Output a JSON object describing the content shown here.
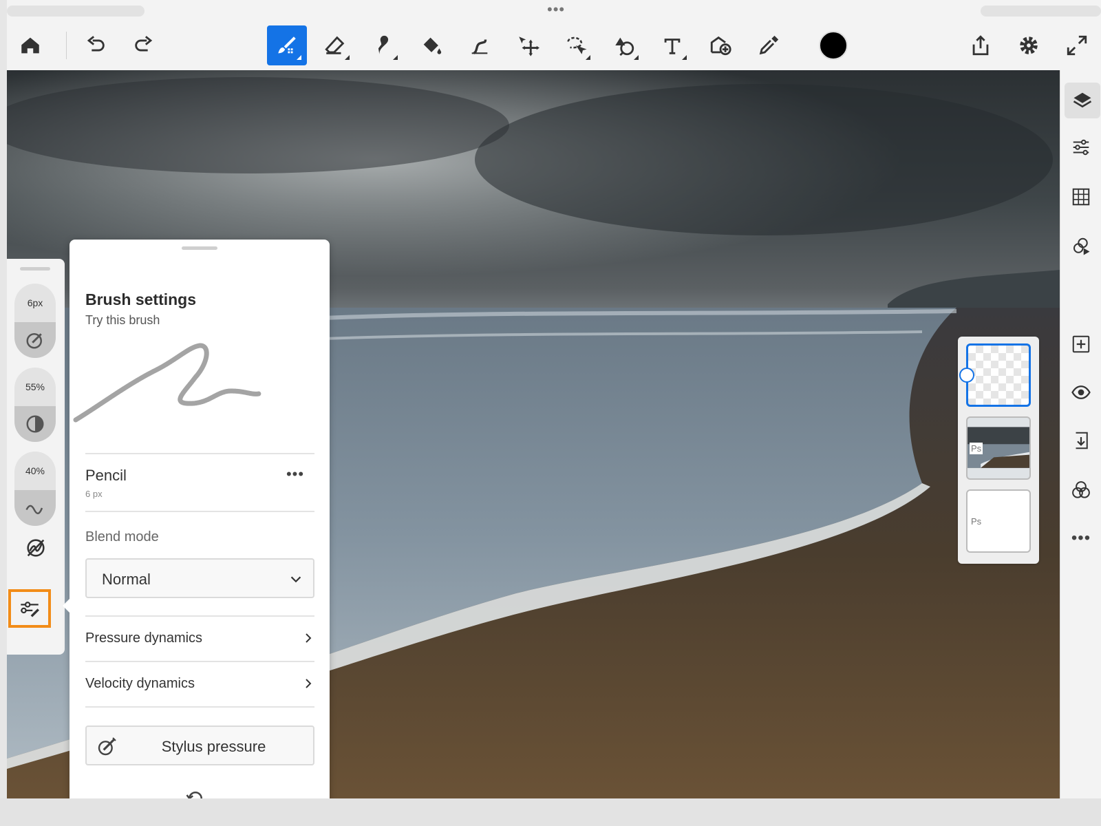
{
  "toolbar": {
    "tools": [
      "home-icon",
      "undo-icon",
      "redo-icon",
      "brush-icon",
      "eraser-icon",
      "smudge-icon",
      "paint-bucket-icon",
      "liquify-icon",
      "move-icon",
      "lasso-icon",
      "healing-icon",
      "type-icon",
      "place-image-icon",
      "eyedropper-icon",
      "share-icon",
      "settings-icon",
      "fullscreen-icon"
    ],
    "active_tool": "brush-icon",
    "active_color": "#000000",
    "accent": "#1473e6"
  },
  "brush_rail": {
    "size_value": "6px",
    "opacity_value": "55%",
    "smoothing_value": "40%",
    "highlight_color": "#f28c18"
  },
  "brush_settings": {
    "title": "Brush settings",
    "subtitle": "Try this brush",
    "brush_name": "Pencil",
    "brush_size": "6 px",
    "more_label": "•••",
    "blend_label": "Blend mode",
    "blend_value": "Normal",
    "pressure_label": "Pressure dynamics",
    "velocity_label": "Velocity dynamics",
    "stylus_label": "Stylus pressure"
  },
  "layers": {
    "ps_tag_1": "Ps",
    "ps_tag_2": "Ps"
  },
  "right_panel": {
    "icons": [
      "layers-icon",
      "adjustments-icon",
      "grid-icon",
      "effects-icon",
      "add-layer-icon",
      "visibility-icon",
      "merge-icon",
      "blend-icon",
      "more-icon"
    ],
    "more_label": "•••"
  }
}
